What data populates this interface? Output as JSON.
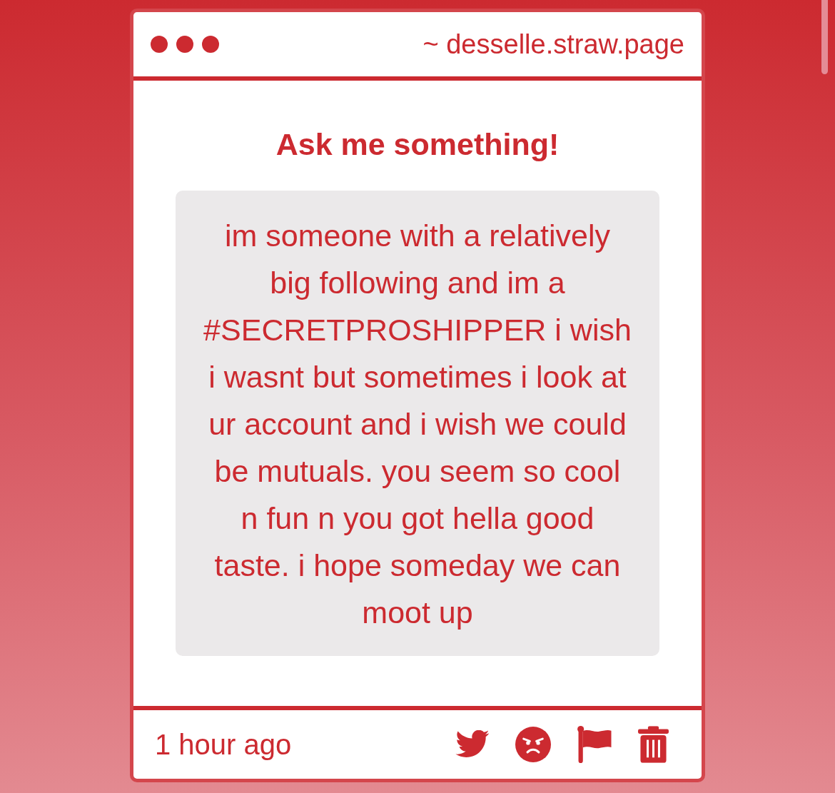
{
  "window": {
    "address": "~ desselle.straw.page"
  },
  "title": "Ask me something!",
  "question": {
    "text": "im someone with a relatively big following and im a #SECRETPROSHIPPER i wish i wasnt but sometimes i look at ur account and i wish we could be mutuals. you seem so cool n fun n you got hella good taste. i hope someday we can moot up"
  },
  "footer": {
    "time": "1 hour ago",
    "actions": [
      {
        "kind": "bird"
      },
      {
        "kind": "angry"
      },
      {
        "kind": "flag"
      },
      {
        "kind": "trash"
      }
    ]
  }
}
